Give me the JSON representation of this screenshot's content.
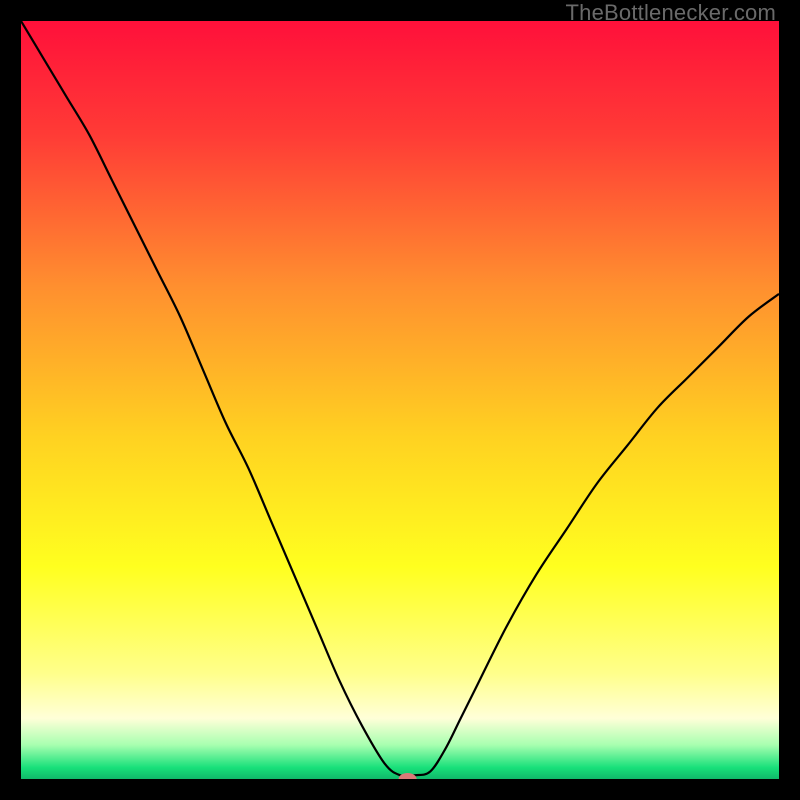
{
  "watermark": "TheBottlenecker.com",
  "chart_data": {
    "type": "line",
    "title": "",
    "xlabel": "",
    "ylabel": "",
    "xlim": [
      0,
      100
    ],
    "ylim": [
      0,
      100
    ],
    "grid": false,
    "background_gradient": {
      "stops": [
        {
          "offset": 0.0,
          "color": "#ff103a"
        },
        {
          "offset": 0.15,
          "color": "#ff3b36"
        },
        {
          "offset": 0.35,
          "color": "#ff8f2f"
        },
        {
          "offset": 0.55,
          "color": "#ffd221"
        },
        {
          "offset": 0.72,
          "color": "#ffff1f"
        },
        {
          "offset": 0.86,
          "color": "#ffff8a"
        },
        {
          "offset": 0.92,
          "color": "#ffffd8"
        },
        {
          "offset": 0.955,
          "color": "#a8ffb0"
        },
        {
          "offset": 0.985,
          "color": "#18e07a"
        },
        {
          "offset": 1.0,
          "color": "#10b86a"
        }
      ]
    },
    "series": [
      {
        "name": "bottleneck-curve",
        "color": "#000000",
        "width": 2.2,
        "x": [
          0.0,
          3,
          6,
          9,
          12,
          15,
          18,
          21,
          24,
          27,
          30,
          33,
          36,
          39,
          42,
          45,
          48,
          50,
          52,
          54,
          56,
          58,
          60,
          64,
          68,
          72,
          76,
          80,
          84,
          88,
          92,
          96,
          100
        ],
        "y": [
          100,
          95,
          90,
          85,
          79,
          73,
          67,
          61,
          54,
          47,
          41,
          34,
          27,
          20,
          13,
          7,
          2,
          0.5,
          0.5,
          1,
          4,
          8,
          12,
          20,
          27,
          33,
          39,
          44,
          49,
          53,
          57,
          61,
          64
        ]
      }
    ],
    "marker": {
      "x": 51,
      "y": 0,
      "rx": 9,
      "ry": 6,
      "color": "#d97a78"
    }
  }
}
